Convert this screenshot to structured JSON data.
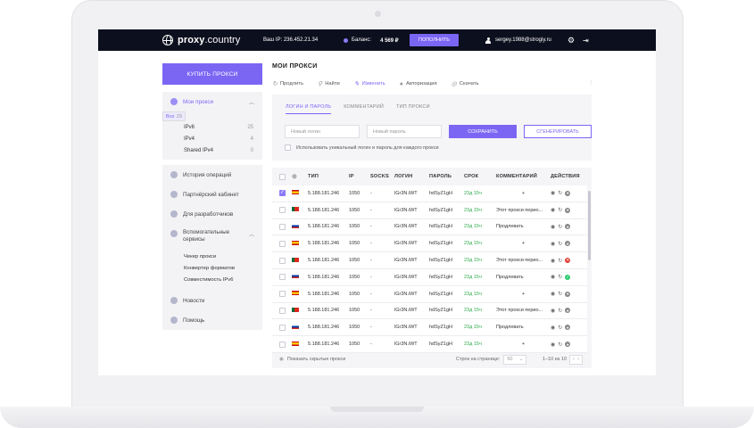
{
  "header": {
    "logo_main": "proxy",
    "logo_domain": ".country",
    "ip_label": "Ваш IP: 236.452.21.34",
    "balance_label": "Баланс:",
    "balance_value": "4 569 ₽",
    "topup_label": "ПОПОЛНИТЬ",
    "user_email": "sergey.1988@strogiy.ru"
  },
  "sidebar": {
    "buy_label": "КУПИТЬ ПРОКСИ",
    "my_proxies": "Мои прокси",
    "filters": [
      {
        "label": "Все",
        "count": "29"
      },
      {
        "label": "IPv6",
        "count": "25"
      },
      {
        "label": "IPv4",
        "count": "4"
      },
      {
        "label": "Shared IPv4",
        "count": "0"
      }
    ],
    "history": "История операций",
    "partner": "Партнёрский кабинет",
    "developers": "Для разработчиков",
    "services": "Вспомогательные сервисы",
    "services_items": [
      "Чекер прокси",
      "Конвертер форматов",
      "Совместимость IPv6"
    ],
    "news": "Новости",
    "help": "Помощь"
  },
  "main": {
    "title": "МОИ ПРОКСИ",
    "toolbar": [
      "Продлить",
      "Найти",
      "Изменить",
      "Авторизация",
      "Скачать"
    ],
    "tabs": [
      "ЛОГИН И ПАРОЛЬ",
      "КОММЕНТАРИЙ",
      "ТИП ПРОКСИ"
    ],
    "login_placeholder": "Новый логин",
    "password_placeholder": "Новый пароль",
    "save_label": "СОХРАНИТЬ",
    "generate_label": "СГЕНЕРИРОВАТЬ",
    "unique_label": "Использовать уникальный логин и пароль для каждого прокси"
  },
  "table": {
    "columns": [
      "ТИП",
      "IP",
      "SOCKS",
      "ЛОГИН",
      "ПАРОЛЬ",
      "СРОК",
      "КОММЕНТАРИЙ",
      "ДЕЙСТВИЯ"
    ],
    "rows": [
      {
        "flag": "es",
        "ip": "5.188.181.246",
        "port": "1050",
        "socks": "-",
        "login": "lGr3N.iWT",
        "password": "hdSyZ1gH",
        "term": "23д 15ч",
        "comment": "+",
        "checked": true,
        "status": "grey"
      },
      {
        "flag": "pt",
        "ip": "5.188.181.246",
        "port": "1050",
        "socks": "-",
        "login": "lGr3N.iWT",
        "password": "hdSyZ1gH",
        "term": "23д 15ч",
        "comment": "Этот прокси перио...",
        "checked": false,
        "status": "grey"
      },
      {
        "flag": "ru",
        "ip": "5.188.181.246",
        "port": "1050",
        "socks": "-",
        "login": "lGr3N.iWT",
        "password": "hdSyZ1gH",
        "term": "23д 15ч",
        "comment": "Продлевать",
        "checked": false,
        "status": "grey"
      },
      {
        "flag": "es",
        "ip": "5.188.181.246",
        "port": "1050",
        "socks": "-",
        "login": "lGr3N.iWT",
        "password": "hdSyZ1gH",
        "term": "23д 15ч",
        "comment": "+",
        "checked": false,
        "status": "grey"
      },
      {
        "flag": "pt",
        "ip": "5.188.181.246",
        "port": "1050",
        "socks": "-",
        "login": "lGr3N.iWT",
        "password": "hdSyZ1gH",
        "term": "23д 15ч",
        "comment": "Этот прокси перио...",
        "checked": false,
        "status": "bad"
      },
      {
        "flag": "ru",
        "ip": "5.188.181.246",
        "port": "1050",
        "socks": "-",
        "login": "lGr3N.iWT",
        "password": "hdSyZ1gH",
        "term": "23д 15ч",
        "comment": "Продлевать",
        "checked": false,
        "status": "good"
      },
      {
        "flag": "es",
        "ip": "5.188.181.246",
        "port": "1050",
        "socks": "-",
        "login": "lGr3N.iWT",
        "password": "hdSyZ1gH",
        "term": "23д 15ч",
        "comment": "+",
        "checked": false,
        "status": "grey"
      },
      {
        "flag": "pt",
        "ip": "5.188.181.246",
        "port": "1050",
        "socks": "-",
        "login": "lGr3N.iWT",
        "password": "hdSyZ1gH",
        "term": "23д 15ч",
        "comment": "Этот прокси перио...",
        "checked": false,
        "status": "grey"
      },
      {
        "flag": "ru",
        "ip": "5.188.181.246",
        "port": "1050",
        "socks": "-",
        "login": "lGr3N.iWT",
        "password": "hdSyZ1gH",
        "term": "23д 15ч",
        "comment": "Продлевать",
        "checked": false,
        "status": "grey"
      },
      {
        "flag": "es",
        "ip": "5.188.181.246",
        "port": "1050",
        "socks": "-",
        "login": "lGr3N.iWT",
        "password": "hdSyZ1gH",
        "term": "23д 15ч",
        "comment": "+",
        "checked": false,
        "status": "grey"
      }
    ],
    "show_hidden": "Показать скрытые прокси",
    "per_page_label": "Строк на странице:",
    "per_page_value": "50",
    "range": "1–10 из 10"
  },
  "colors": {
    "accent": "#7b66f4",
    "topbar": "#0c0f1d",
    "term": "#2ea94c"
  },
  "icons": [
    "globe-icon",
    "user-icon",
    "gear-icon",
    "logout-icon",
    "eye-icon",
    "refresh-icon",
    "check-icon"
  ]
}
